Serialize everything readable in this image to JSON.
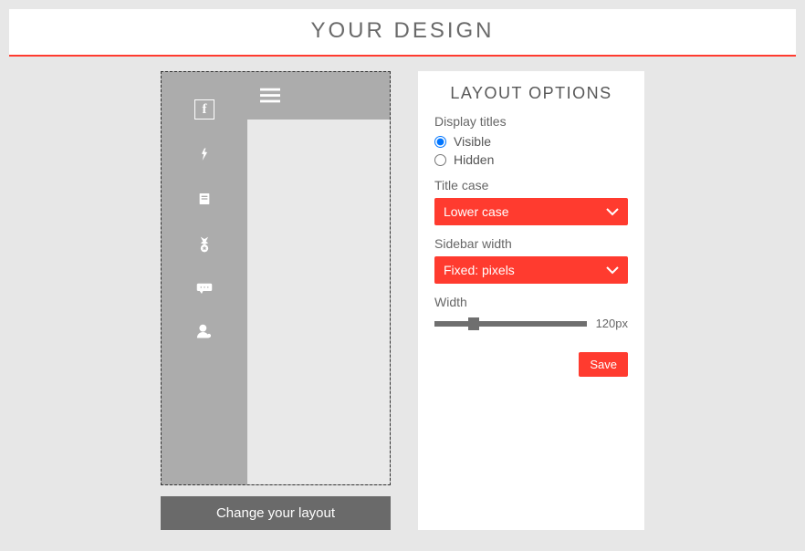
{
  "header": {
    "title": "YOUR DESIGN"
  },
  "preview": {
    "sidebar_icons": [
      "facebook",
      "microphone",
      "clipboard",
      "medal",
      "comment",
      "user-settings"
    ],
    "change_layout_label": "Change your layout"
  },
  "options": {
    "title": "LAYOUT OPTIONS",
    "display_titles": {
      "label": "Display titles",
      "visible_label": "Visible",
      "hidden_label": "Hidden",
      "selected": "visible"
    },
    "title_case": {
      "label": "Title case",
      "selected": "Lower case"
    },
    "sidebar_width": {
      "label": "Sidebar width",
      "selected": "Fixed: pixels"
    },
    "width": {
      "label": "Width",
      "value": "120px"
    },
    "save_label": "Save"
  }
}
